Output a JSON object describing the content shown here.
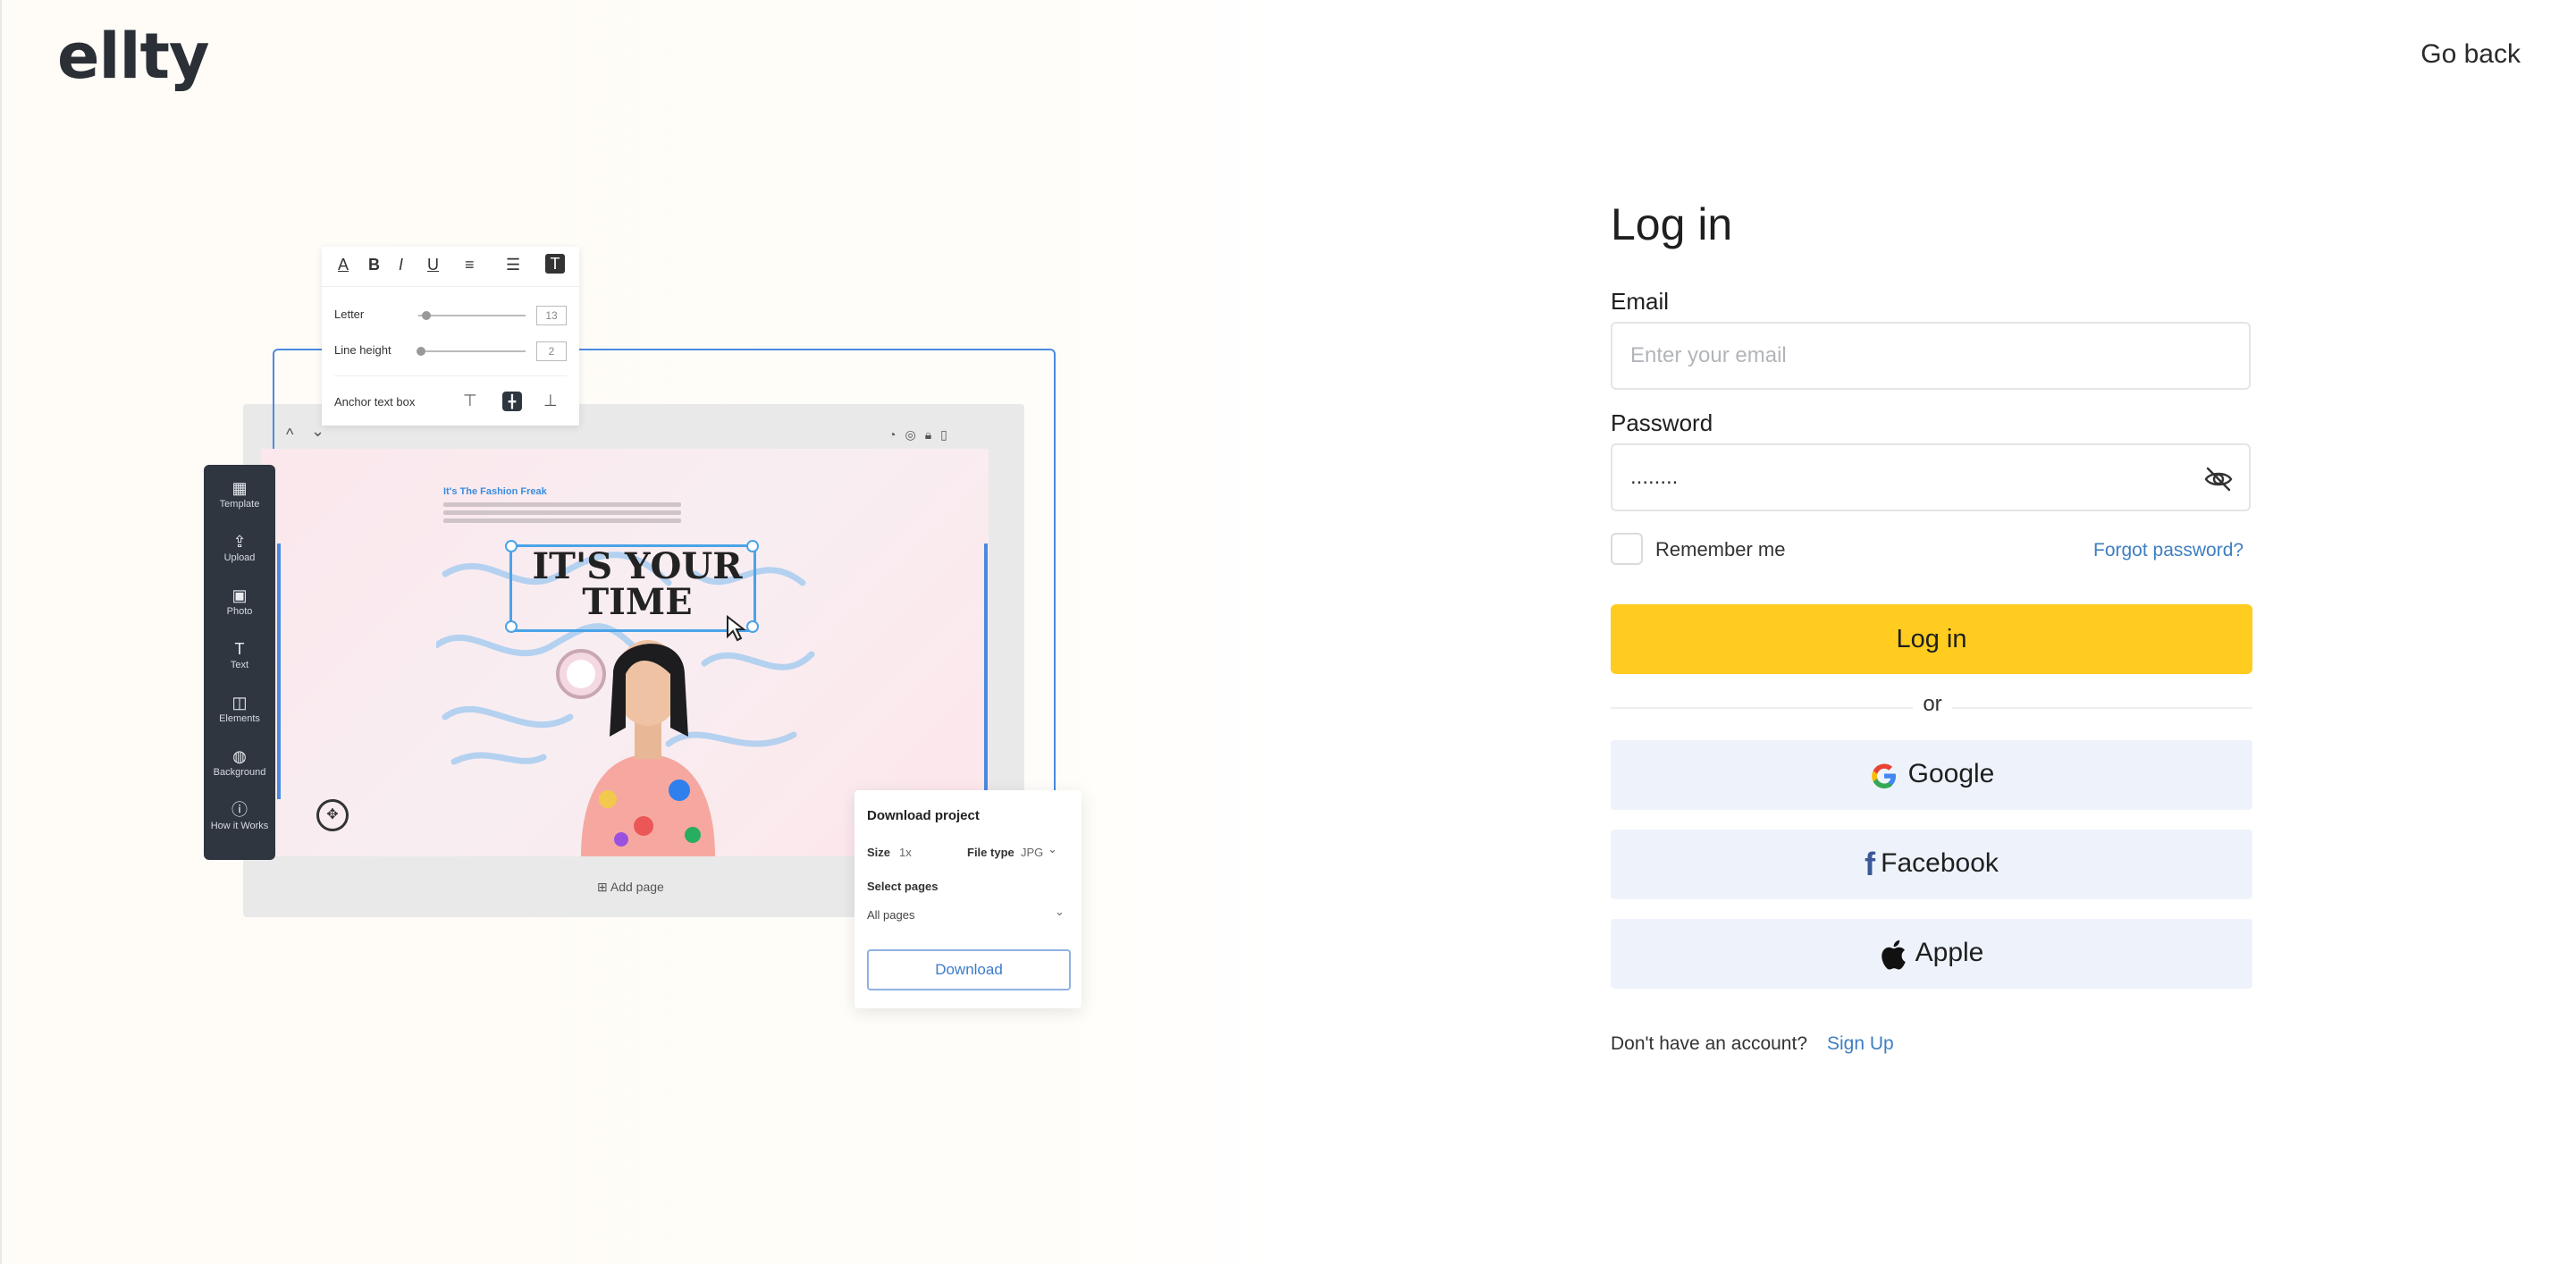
{
  "brand": {
    "logo": "ellty"
  },
  "header": {
    "go_back": "Go back"
  },
  "illustration": {
    "format_toolbar": [
      "A",
      "B",
      "I",
      "U",
      "≡",
      "☰",
      "T"
    ],
    "letter_label": "Letter",
    "letter_value": "13",
    "line_height_label": "Line height",
    "line_height_value": "2",
    "anchor_label": "Anchor text box",
    "sidebar": [
      {
        "label": "Template",
        "icon": "template-icon"
      },
      {
        "label": "Upload",
        "icon": "upload-icon"
      },
      {
        "label": "Photo",
        "icon": "photo-icon"
      },
      {
        "label": "Text",
        "icon": "text-icon"
      },
      {
        "label": "Elements",
        "icon": "elements-icon"
      },
      {
        "label": "Background",
        "icon": "background-icon"
      },
      {
        "label": "How it Works",
        "icon": "info-icon"
      }
    ],
    "canvas_small_title": "It's The Fashion Freak",
    "headline": "IT'S YOUR TIME",
    "add_page": "Add page",
    "download_panel": {
      "title": "Download project",
      "size_label": "Size",
      "size_value": "1x",
      "file_type_label": "File type",
      "file_type_value": "JPG",
      "select_pages_label": "Select pages",
      "pages_value": "All pages",
      "download_button": "Download"
    }
  },
  "login": {
    "title": "Log in",
    "email_label": "Email",
    "email_placeholder": "Enter your email",
    "password_label": "Password",
    "password_value": "........",
    "remember_me": "Remember me",
    "forgot_password": "Forgot password?",
    "submit": "Log in",
    "or": "or",
    "google": "Google",
    "facebook": "Facebook",
    "apple": "Apple",
    "no_account": "Don't have an account?",
    "sign_up": "Sign Up"
  },
  "colors": {
    "accent": "#ffcc1f",
    "link": "#3e7fc1",
    "social_bg": "#eef3fb",
    "toolbar_dark": "#2f3640"
  }
}
